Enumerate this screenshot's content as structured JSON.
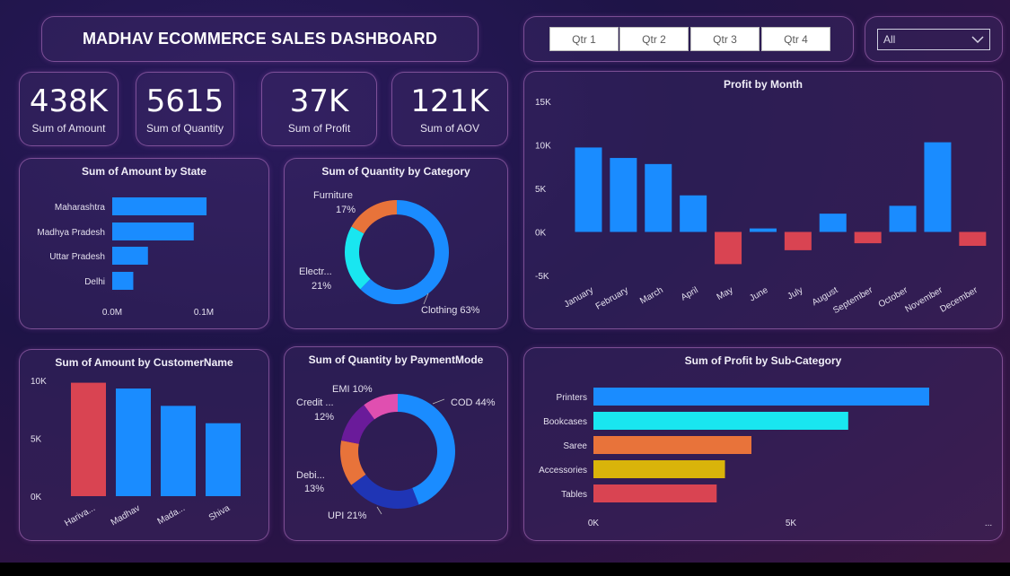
{
  "header": {
    "title": "MADHAV ECOMMERCE SALES DASHBOARD"
  },
  "slicer": {
    "quarters": [
      "Qtr 1",
      "Qtr 2",
      "Qtr 3",
      "Qtr 4"
    ],
    "dropdown_value": "All"
  },
  "kpis": [
    {
      "value": "438K",
      "label": "Sum of Amount"
    },
    {
      "value": "5615",
      "label": "Sum of Quantity"
    },
    {
      "value": "37K",
      "label": "Sum of Profit"
    },
    {
      "value": "121K",
      "label": "Sum of AOV"
    }
  ],
  "colors": {
    "blue": "#1a8cff",
    "red": "#d94452",
    "cyan": "#19e6f0",
    "orange": "#e8733a",
    "yellow": "#d9b40a",
    "purple": "#6a1b9a",
    "pink": "#e04fb0",
    "navy": "#1f35b5"
  },
  "chart_data": [
    {
      "id": "state",
      "type": "bar",
      "orientation": "horizontal",
      "title": "Sum of Amount by State",
      "categories": [
        "Maharashtra",
        "Madhya Pradesh",
        "Uttar Pradesh",
        "Delhi"
      ],
      "values": [
        0.103,
        0.089,
        0.039,
        0.023
      ],
      "xticks": [
        "0.0M",
        "0.1M"
      ],
      "xlim": [
        0,
        0.1
      ]
    },
    {
      "id": "category",
      "type": "pie",
      "donut": true,
      "title": "Sum of Quantity by Category",
      "labels": [
        "Clothing",
        "Electr...",
        "Furniture"
      ],
      "values": [
        63,
        21,
        17
      ],
      "value_labels": [
        "63%",
        "21%",
        "17%"
      ]
    },
    {
      "id": "month",
      "type": "bar",
      "title": "Profit by Month",
      "categories": [
        "January",
        "February",
        "March",
        "April",
        "May",
        "June",
        "July",
        "August",
        "September",
        "October",
        "November",
        "December"
      ],
      "values": [
        9700,
        8500,
        7800,
        4200,
        -3700,
        400,
        -2100,
        2100,
        -1300,
        3000,
        10300,
        -1600
      ],
      "yticks": [
        "15K",
        "10K",
        "5K",
        "0K",
        "-5K"
      ],
      "ylim": [
        -5000,
        15000
      ]
    },
    {
      "id": "customer",
      "type": "bar",
      "title": "Sum of Amount by CustomerName",
      "categories": [
        "Harivans",
        "Madhav",
        "Madan Mohan",
        "Shiva"
      ],
      "tick_labels": [
        "Hariva...",
        "Madhav",
        "Mada...",
        "Shiva"
      ],
      "values": [
        9800,
        9300,
        7800,
        6300
      ],
      "yticks": [
        "10K",
        "5K",
        "0K"
      ],
      "ylim": [
        0,
        10000
      ]
    },
    {
      "id": "payment",
      "type": "pie",
      "donut": true,
      "title": "Sum of Quantity by PaymentMode",
      "labels": [
        "COD",
        "UPI",
        "Debi...",
        "Credit ...",
        "EMI"
      ],
      "values": [
        44,
        21,
        13,
        12,
        10
      ],
      "value_labels": [
        "44%",
        "21%",
        "13%",
        "12%",
        "10%"
      ]
    },
    {
      "id": "subcat",
      "type": "bar",
      "orientation": "horizontal",
      "title": "Sum of Profit by Sub-Category",
      "categories": [
        "Printers",
        "Bookcases",
        "Saree",
        "Accessories",
        "Tables"
      ],
      "values": [
        8500,
        6450,
        4000,
        3330,
        3120
      ],
      "xticks": [
        "0K",
        "5K",
        "..."
      ],
      "xlim": [
        0,
        5000
      ]
    }
  ]
}
